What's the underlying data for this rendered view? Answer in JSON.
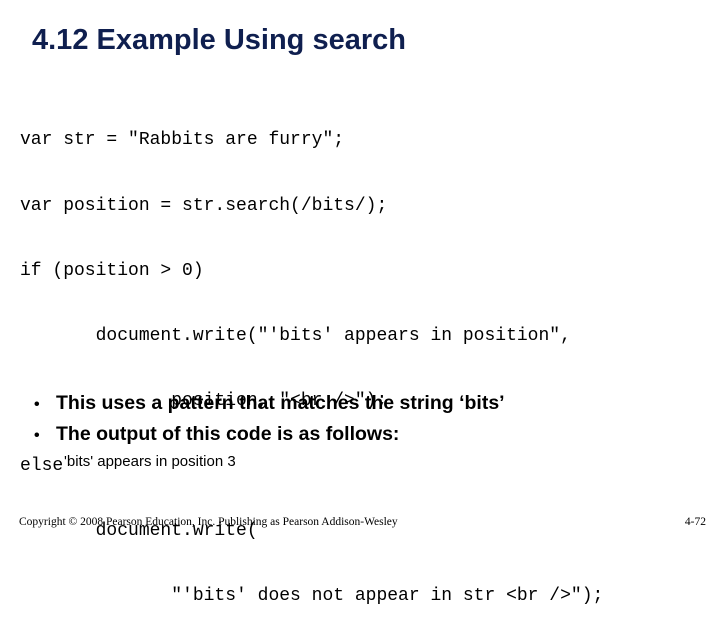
{
  "slide": {
    "title": "4.12 Example Using search",
    "code_lines": [
      "var str = \"Rabbits are furry\";",
      "var position = str.search(/bits/);",
      "if (position > 0)",
      "       document.write(\"'bits' appears in position\",",
      "              position, \"<br />\");",
      "else",
      "       document.write(",
      "              \"'bits' does not appear in str <br />\");"
    ],
    "bullets": [
      "This uses a pattern that matches the string ‘bits’",
      "The output of this code is as follows:"
    ],
    "bullet_glyph": "•",
    "output_text": "'bits' appears in position 3",
    "footer": {
      "copyright": "Copyright © 2008 Pearson Education, Inc. Publishing as Pearson Addison-Wesley",
      "page_number": "4-72"
    },
    "colors": {
      "title": "#0f1f4f",
      "text": "#000000"
    }
  }
}
